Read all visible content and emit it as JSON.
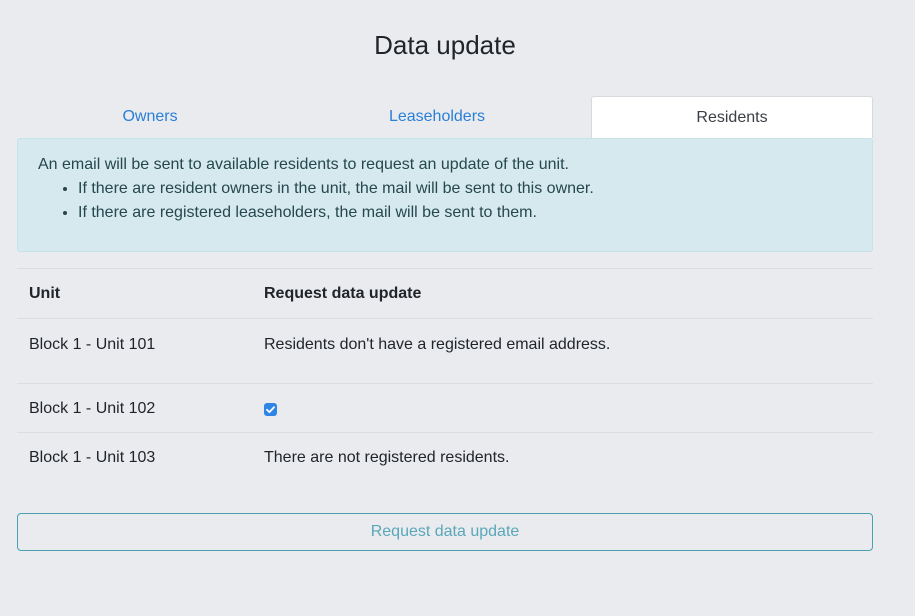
{
  "page": {
    "title": "Data update"
  },
  "tabs": [
    {
      "label": "Owners",
      "active": false
    },
    {
      "label": "Leaseholders",
      "active": false
    },
    {
      "label": "Residents",
      "active": true
    }
  ],
  "alert": {
    "intro": "An email will be sent to available residents to request an update of the unit.",
    "items": [
      "If there are resident owners in the unit, the mail will be sent to this owner.",
      "If there are registered leaseholders, the mail will be sent to them."
    ]
  },
  "table": {
    "headers": {
      "unit": "Unit",
      "request": "Request data update"
    },
    "rows": [
      {
        "unit": "Block 1 - Unit 101",
        "request_text": "Residents don't have a registered email address."
      },
      {
        "unit": "Block 1 - Unit 102",
        "request_checked": true
      },
      {
        "unit": "Block 1 - Unit 103",
        "request_text": "There are not registered residents."
      }
    ]
  },
  "actions": {
    "submit_label": "Request data update"
  },
  "colors": {
    "accent": "#2a7fd6",
    "alert_bg": "#d6e9ee",
    "button_border": "#4aa0b3",
    "checkbox": "#2f85e6"
  },
  "icons": {
    "checkbox": "checkmark-icon"
  }
}
